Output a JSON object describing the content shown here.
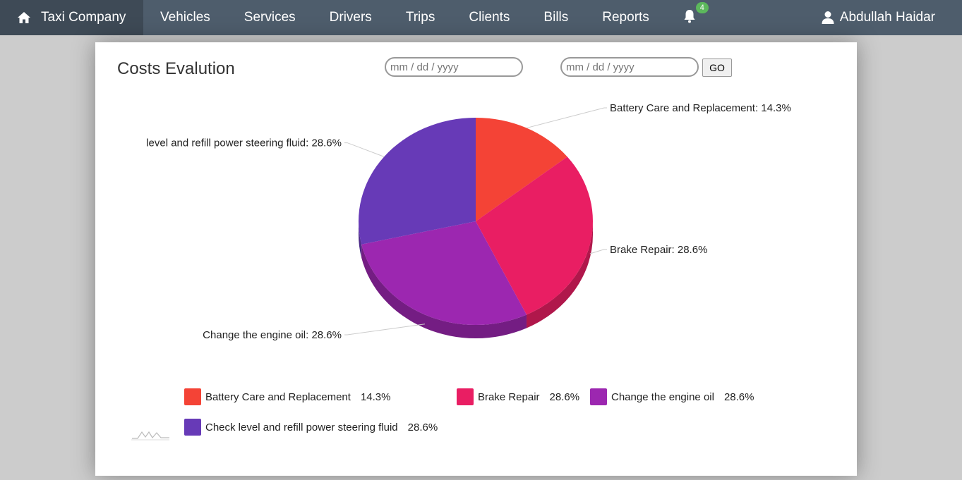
{
  "navbar": {
    "brand": "Taxi Company",
    "items": [
      "Vehicles",
      "Services",
      "Drivers",
      "Trips",
      "Clients",
      "Bills",
      "Reports"
    ],
    "notification_count": "4",
    "user_name": "Abdullah Haidar"
  },
  "page": {
    "title": "Costs Evalution",
    "date_from_placeholder": "mm / dd / yyyy",
    "date_to_placeholder": "mm / dd / yyyy",
    "go_label": "GO"
  },
  "chart_data": {
    "type": "pie",
    "title": "",
    "slices": [
      {
        "name": "Battery Care and Replacement",
        "label": "Battery Care and Replacement: 14.3%",
        "value": 14.3,
        "pct_text": "14.3%",
        "color": "#f44336",
        "dark": "#b8302a"
      },
      {
        "name": "Brake Repair",
        "label": "Brake Repair: 28.6%",
        "value": 28.6,
        "pct_text": "28.6%",
        "color": "#e91e63",
        "dark": "#b0174b"
      },
      {
        "name": "Change the engine oil",
        "label": "Change the engine oil: 28.6%",
        "value": 28.6,
        "pct_text": "28.6%",
        "color": "#9c27b0",
        "dark": "#741d83"
      },
      {
        "name": "Check level and refill power steering fluid",
        "label": "level and refill power steering fluid: 28.6%",
        "value": 28.6,
        "pct_text": "28.6%",
        "color": "#673ab7",
        "dark": "#4c2b88"
      }
    ],
    "legend_position": "bottom"
  }
}
